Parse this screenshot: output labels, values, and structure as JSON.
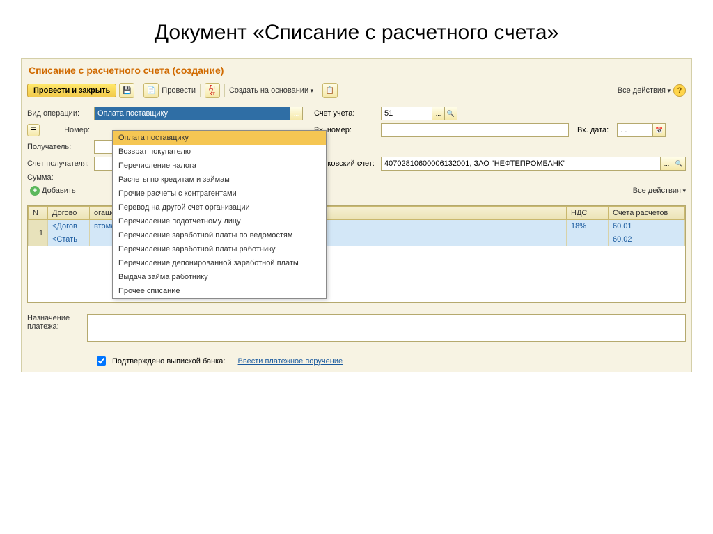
{
  "page_title": "Документ «Списание с расчетного счета»",
  "window_title": "Списание с расчетного счета (создание)",
  "toolbar": {
    "post_close": "Провести и закрыть",
    "post": "Провести",
    "create_from": "Создать на основании",
    "all_actions": "Все действия"
  },
  "form": {
    "operation_type_label": "Вид операции:",
    "operation_type_value": "Оплата поставщику",
    "number_label": "Номер:",
    "recipient_label": "Получатель:",
    "recipient_account_label": "Счет получателя:",
    "amount_label": "Сумма:",
    "account_label": "Счет учета:",
    "account_value": "51",
    "in_number_label": "Вх. номер:",
    "in_date_label": "Вх. дата:",
    "in_date_value": ". .",
    "bank_account_label": "Банковский счет:",
    "bank_account_value": "40702810600006132001, ЗАО \"НЕФТЕПРОМБАНК\""
  },
  "dropdown_items": [
    "Оплата поставщику",
    "Возврат покупателю",
    "Перечисление налога",
    "Расчеты по кредитам и займам",
    "Прочие расчеты с контрагентами",
    "Перевод на другой счет организации",
    "Перечисление подотчетному лицу",
    "Перечисление заработной платы по ведомостям",
    "Перечисление заработной платы работнику",
    "Перечисление депонированной заработной платы",
    "Выдача займа работнику",
    "Прочее списание"
  ],
  "add_label": "Добавить",
  "table": {
    "headers": [
      "N",
      "Догово",
      "огашение задолженности",
      "НДС",
      "Счета расчетов"
    ],
    "row1": {
      "n": "1",
      "c1": "<Догов",
      "c2": "втоматически",
      "c3": "18%",
      "c4": "60.01"
    },
    "row2": {
      "c1": "<Стать",
      "c4": "60.02"
    }
  },
  "bottom": {
    "purpose_label": "Назначение платежа:",
    "confirmed_label": "Подтверждено выпиской банка:",
    "enter_payment": "Ввести платежное поручение"
  }
}
